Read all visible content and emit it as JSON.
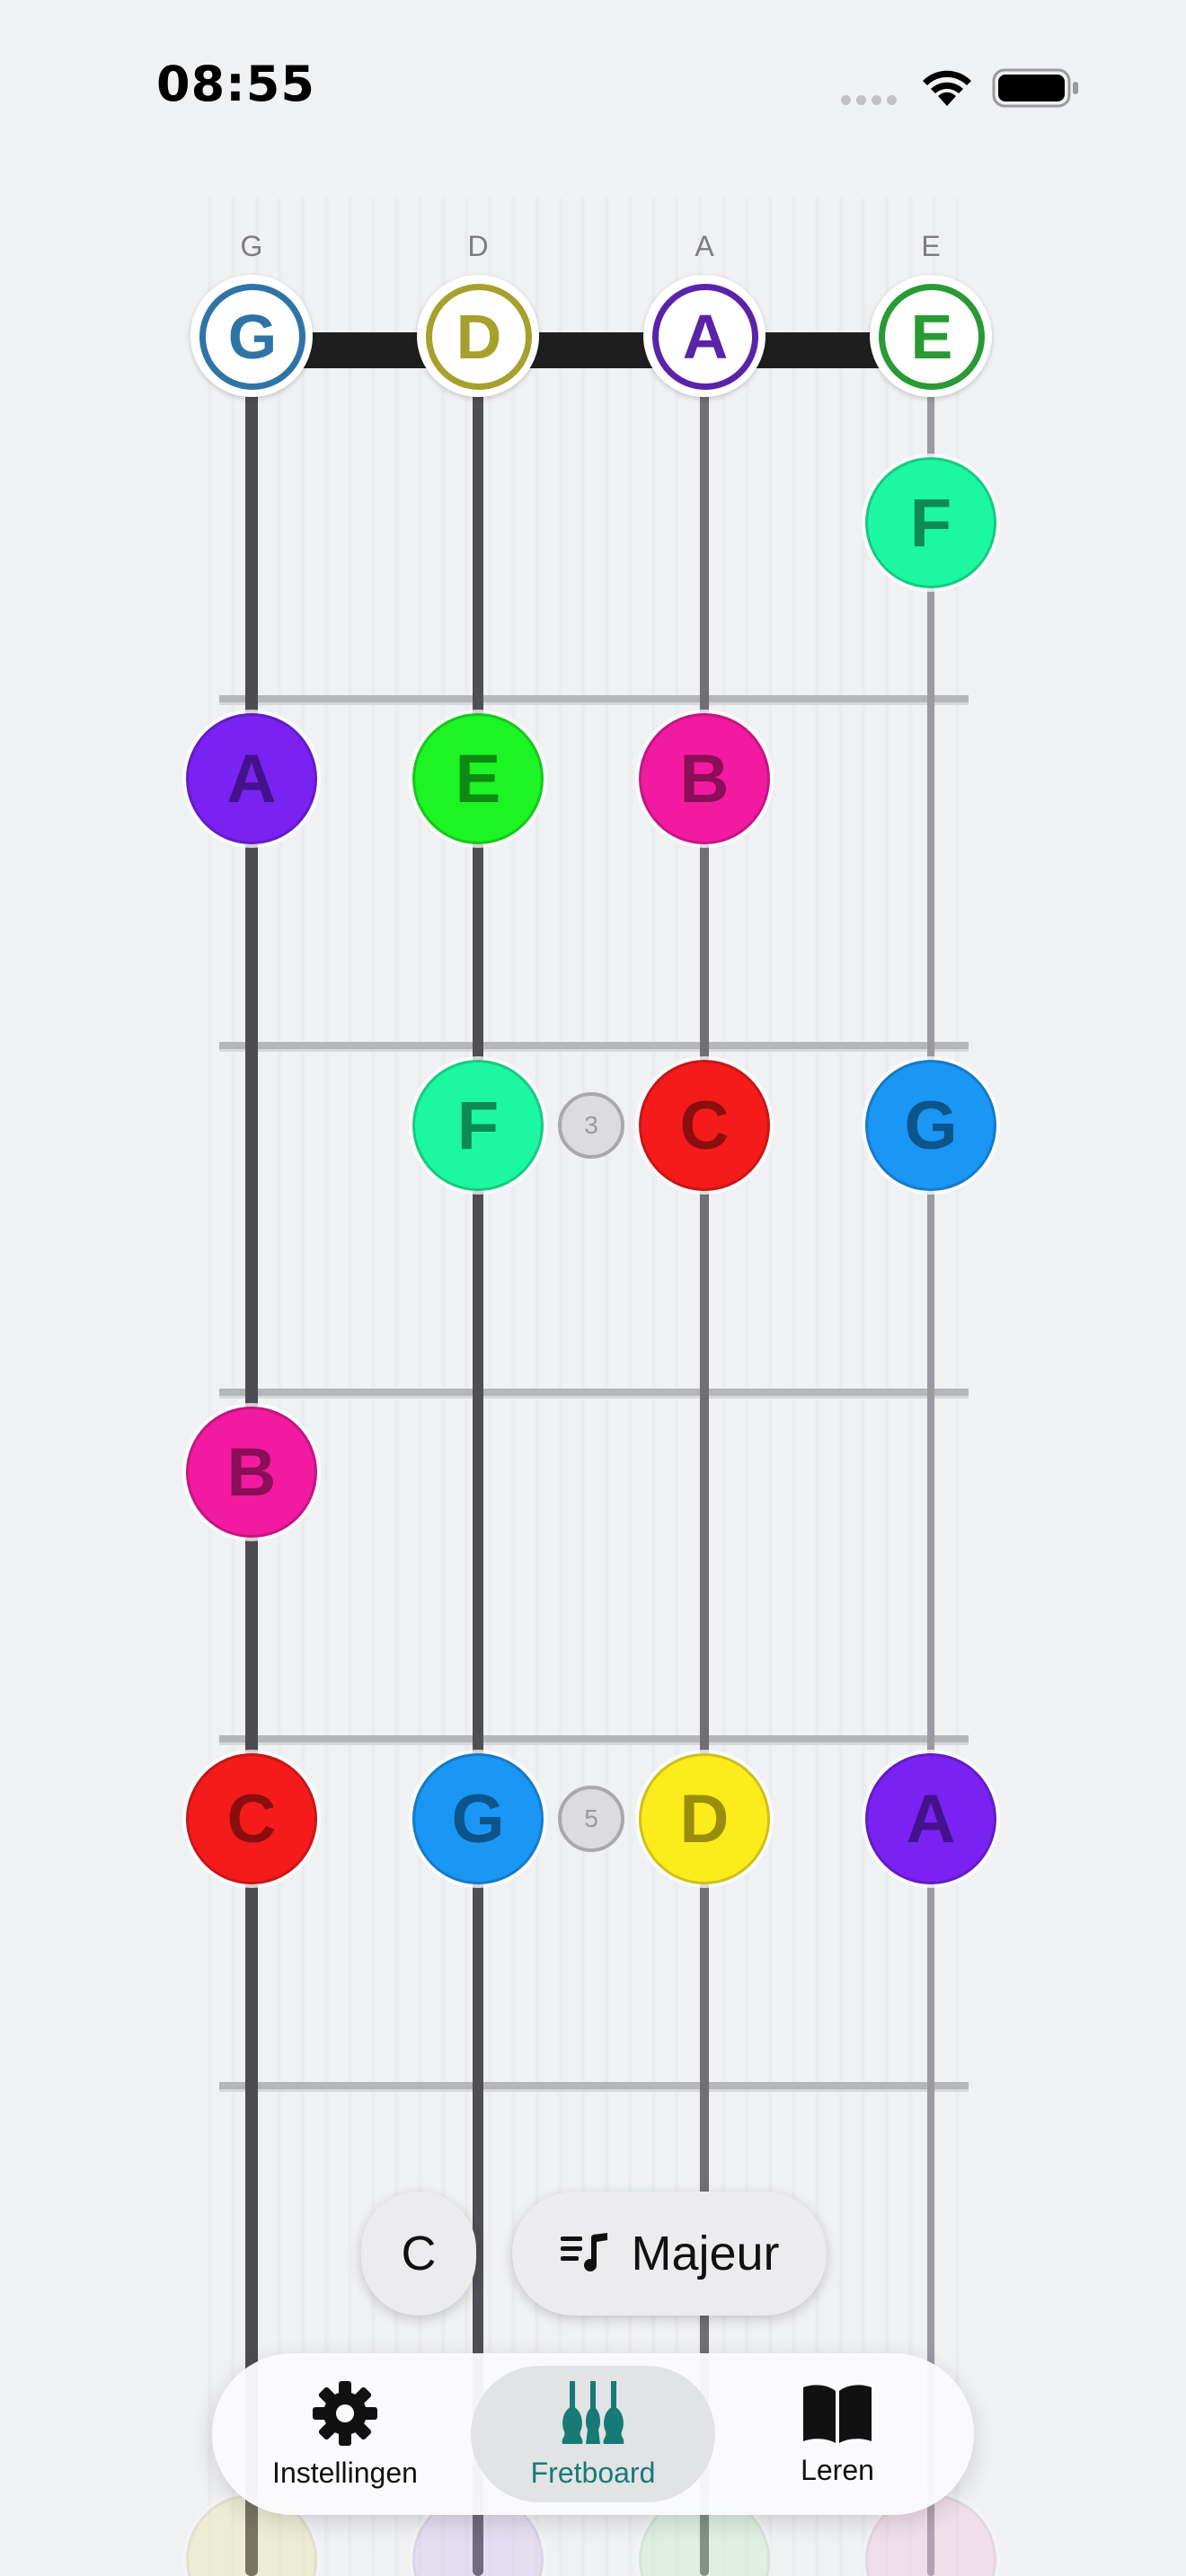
{
  "status_bar": {
    "time": "08:55"
  },
  "strings": [
    {
      "name": "G",
      "open_note": "G",
      "ring_color": "#2f74a6"
    },
    {
      "name": "D",
      "open_note": "D",
      "ring_color": "#a6a02c"
    },
    {
      "name": "A",
      "open_note": "A",
      "ring_color": "#5b23a8"
    },
    {
      "name": "E",
      "open_note": "E",
      "ring_color": "#2a9a34"
    }
  ],
  "notes": [
    {
      "string": 3,
      "fret": 1,
      "label": "F",
      "color": "#1cf7a2",
      "text_color": "#0f8a55"
    },
    {
      "string": 0,
      "fret": 2,
      "label": "A",
      "color": "#7a22f2",
      "text_color": "#44128a"
    },
    {
      "string": 1,
      "fret": 2,
      "label": "E",
      "color": "#1cf423",
      "text_color": "#0d8a13"
    },
    {
      "string": 2,
      "fret": 2,
      "label": "B",
      "color": "#f21aa0",
      "text_color": "#8a0e58"
    },
    {
      "string": 1,
      "fret": 3,
      "label": "F",
      "color": "#1cf7a2",
      "text_color": "#0f8a55"
    },
    {
      "string": 2,
      "fret": 3,
      "label": "C",
      "color": "#f51b1b",
      "text_color": "#8a0e0e"
    },
    {
      "string": 3,
      "fret": 3,
      "label": "G",
      "color": "#1a96f5",
      "text_color": "#0d548a"
    },
    {
      "string": 0,
      "fret": 4,
      "label": "B",
      "color": "#f21aa0",
      "text_color": "#8a0e58"
    },
    {
      "string": 0,
      "fret": 5,
      "label": "C",
      "color": "#f51b1b",
      "text_color": "#8a0e0e"
    },
    {
      "string": 1,
      "fret": 5,
      "label": "G",
      "color": "#1a96f5",
      "text_color": "#0d548a"
    },
    {
      "string": 2,
      "fret": 5,
      "label": "D",
      "color": "#fcec1c",
      "text_color": "#9a8c0d"
    },
    {
      "string": 3,
      "fret": 5,
      "label": "A",
      "color": "#7a22f2",
      "text_color": "#44128a"
    }
  ],
  "faded_notes": [
    {
      "string": 0,
      "fret": 7,
      "color": "#e8e08a"
    },
    {
      "string": 1,
      "fret": 7,
      "color": "#c9b0f0"
    },
    {
      "string": 2,
      "fret": 7,
      "color": "#b5ecb7"
    },
    {
      "string": 3,
      "fret": 7,
      "color": "#f3b2d9"
    }
  ],
  "fret_markers": [
    {
      "fret": 3,
      "label": "3"
    },
    {
      "fret": 5,
      "label": "5"
    }
  ],
  "controls": {
    "key": "C",
    "scale": "Majeur"
  },
  "tabbar": {
    "settings_label": "Instellingen",
    "fretboard_label": "Fretboard",
    "learn_label": "Leren",
    "active_color": "#177a76"
  }
}
